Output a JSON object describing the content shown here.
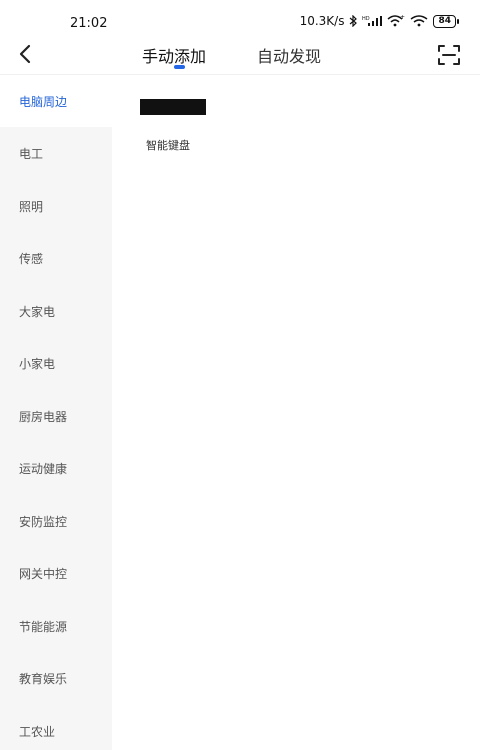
{
  "status_bar": {
    "time": "21:02",
    "network_speed": "10.3K/s",
    "battery": "84",
    "icons": [
      "bluetooth-icon",
      "signal-icon",
      "wifi-icon",
      "battery-icon"
    ]
  },
  "header": {
    "tabs": [
      {
        "label": "手动添加",
        "active": true
      },
      {
        "label": "自动发现",
        "active": false
      }
    ],
    "accent_color": "#2468e8"
  },
  "sidebar": {
    "items": [
      {
        "label": "电脑周边",
        "active": true
      },
      {
        "label": "电工",
        "active": false
      },
      {
        "label": "照明",
        "active": false
      },
      {
        "label": "传感",
        "active": false
      },
      {
        "label": "大家电",
        "active": false
      },
      {
        "label": "小家电",
        "active": false
      },
      {
        "label": "厨房电器",
        "active": false
      },
      {
        "label": "运动健康",
        "active": false
      },
      {
        "label": "安防监控",
        "active": false
      },
      {
        "label": "网关中控",
        "active": false
      },
      {
        "label": "节能能源",
        "active": false
      },
      {
        "label": "教育娱乐",
        "active": false
      },
      {
        "label": "工农业",
        "active": false
      }
    ]
  },
  "content": {
    "devices": [
      {
        "label": "智能键盘"
      }
    ]
  }
}
